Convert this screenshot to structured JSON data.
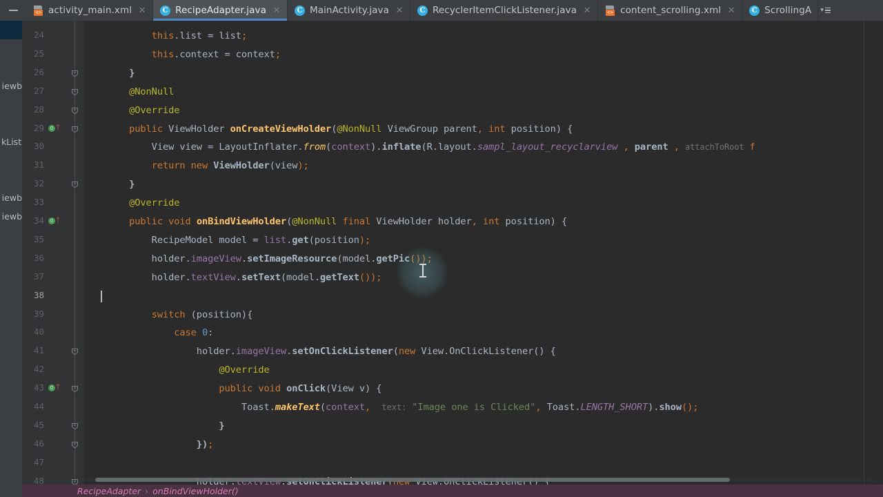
{
  "window": {
    "theme_bg": "#2b2b2b",
    "chrome_bg": "#3c3f41",
    "accent": "#4a88c7",
    "collapse_label": "—"
  },
  "tabs": {
    "items": [
      {
        "label": "activity_main.xml",
        "icon": "xml-file-icon",
        "icon_char": "<>",
        "active": false,
        "close": "✕"
      },
      {
        "label": "RecipeAdapter.java",
        "icon": "java-class-icon",
        "icon_char": "C",
        "active": true,
        "close": "✕"
      },
      {
        "label": "MainActivity.java",
        "icon": "java-class-icon",
        "icon_char": "C",
        "active": false,
        "close": "✕"
      },
      {
        "label": "RecyclerItemClickListener.java",
        "icon": "java-class-icon",
        "icon_char": "C",
        "active": false,
        "close": "✕"
      },
      {
        "label": "content_scrolling.xml",
        "icon": "xml-file-icon",
        "icon_char": "<>",
        "active": false,
        "close": "✕"
      },
      {
        "label": "ScrollingA",
        "icon": "java-class-icon",
        "icon_char": "C",
        "active": false,
        "close": ""
      }
    ],
    "overflow_label": "▾"
  },
  "project_panel": {
    "rows": [
      {
        "text": "",
        "selected": true
      },
      {
        "text": "",
        "selected": false
      },
      {
        "text": "",
        "selected": false
      },
      {
        "text": "viewb",
        "selected": false
      },
      {
        "text": "",
        "selected": false
      },
      {
        "text": "",
        "selected": false
      },
      {
        "text": "kList",
        "selected": false
      },
      {
        "text": "",
        "selected": false
      },
      {
        "text": "",
        "selected": false
      },
      {
        "text": "viewb",
        "selected": false
      },
      {
        "text": "viewb",
        "selected": false
      }
    ]
  },
  "editor": {
    "first_line": 24,
    "current_line": 38,
    "caret": {
      "line": 38,
      "col": 9
    },
    "run_marker_lines": [
      29,
      34,
      43
    ],
    "run_marker_glyph": "O",
    "run_marker_arrow": "↑",
    "fold_lines": [
      26,
      27,
      28,
      29,
      32,
      41,
      43,
      45,
      46,
      48
    ],
    "line_numbers": [
      24,
      25,
      26,
      27,
      28,
      29,
      30,
      31,
      32,
      33,
      34,
      35,
      36,
      37,
      38,
      39,
      40,
      41,
      42,
      43,
      44,
      45,
      46,
      47,
      48
    ],
    "lines": [
      {
        "n": 24,
        "tokens": [
          {
            "t": "            ",
            "c": "plain"
          },
          {
            "t": "this",
            "c": "kw"
          },
          {
            "t": ".",
            "c": "plain"
          },
          {
            "t": "list",
            "c": "ident"
          },
          {
            "t": " = ",
            "c": "plain"
          },
          {
            "t": "list",
            "c": "ident"
          },
          {
            "t": ";",
            "c": "semi"
          }
        ]
      },
      {
        "n": 25,
        "tokens": [
          {
            "t": "            ",
            "c": "plain"
          },
          {
            "t": "this",
            "c": "kw"
          },
          {
            "t": ".",
            "c": "plain"
          },
          {
            "t": "context",
            "c": "ident"
          },
          {
            "t": " = ",
            "c": "plain"
          },
          {
            "t": "context",
            "c": "ident"
          },
          {
            "t": ";",
            "c": "semi"
          }
        ]
      },
      {
        "n": 26,
        "tokens": [
          {
            "t": "        }",
            "c": "bold"
          }
        ]
      },
      {
        "n": 27,
        "tokens": [
          {
            "t": "        ",
            "c": "plain"
          },
          {
            "t": "@NonNull",
            "c": "ann"
          }
        ]
      },
      {
        "n": 28,
        "tokens": [
          {
            "t": "        ",
            "c": "plain"
          },
          {
            "t": "@Override",
            "c": "ann"
          }
        ]
      },
      {
        "n": 29,
        "tokens": [
          {
            "t": "        ",
            "c": "plain"
          },
          {
            "t": "public",
            "c": "kw"
          },
          {
            "t": " ",
            "c": "plain"
          },
          {
            "t": "ViewHolder",
            "c": "ident"
          },
          {
            "t": " ",
            "c": "plain"
          },
          {
            "t": "onCreateViewHolder",
            "c": "mthb"
          },
          {
            "t": "(",
            "c": "plain"
          },
          {
            "t": "@NonNull",
            "c": "ann"
          },
          {
            "t": " ViewGroup parent",
            "c": "ident"
          },
          {
            "t": ",",
            "c": "semi"
          },
          {
            "t": " ",
            "c": "plain"
          },
          {
            "t": "int",
            "c": "kw"
          },
          {
            "t": " position",
            "c": "ident"
          },
          {
            "t": ") {",
            "c": "plain"
          }
        ]
      },
      {
        "n": 30,
        "tokens": [
          {
            "t": "            View view = LayoutInflater.",
            "c": "ident"
          },
          {
            "t": "from",
            "c": "mth-ital"
          },
          {
            "t": "(",
            "c": "plain"
          },
          {
            "t": "context",
            "c": "fld"
          },
          {
            "t": ").",
            "c": "plain"
          },
          {
            "t": "inflate",
            "c": "bold"
          },
          {
            "t": "(R.layout.",
            "c": "ident"
          },
          {
            "t": "sampl_layout_recyclarview",
            "c": "sfld"
          },
          {
            "t": " , ",
            "c": "semi"
          },
          {
            "t": "parent",
            "c": "bold"
          },
          {
            "t": " , ",
            "c": "semi"
          },
          {
            "t": "attachToRoot",
            "c": "hint"
          },
          {
            "t": " f",
            "c": "kw"
          }
        ]
      },
      {
        "n": 31,
        "tokens": [
          {
            "t": "            ",
            "c": "plain"
          },
          {
            "t": "return",
            "c": "kw"
          },
          {
            "t": " ",
            "c": "plain"
          },
          {
            "t": "new",
            "c": "kw"
          },
          {
            "t": " ",
            "c": "plain"
          },
          {
            "t": "ViewHolder",
            "c": "bold"
          },
          {
            "t": "(view",
            "c": "ident"
          },
          {
            "t": ");",
            "c": "semi"
          }
        ]
      },
      {
        "n": 32,
        "tokens": [
          {
            "t": "        }",
            "c": "bold"
          }
        ]
      },
      {
        "n": 33,
        "tokens": [
          {
            "t": "        ",
            "c": "plain"
          },
          {
            "t": "@Override",
            "c": "ann"
          }
        ]
      },
      {
        "n": 34,
        "tokens": [
          {
            "t": "        ",
            "c": "plain"
          },
          {
            "t": "public",
            "c": "kw"
          },
          {
            "t": " ",
            "c": "plain"
          },
          {
            "t": "void",
            "c": "kw"
          },
          {
            "t": " ",
            "c": "plain"
          },
          {
            "t": "onBindViewHolder",
            "c": "mthb"
          },
          {
            "t": "(",
            "c": "plain"
          },
          {
            "t": "@NonNull",
            "c": "ann"
          },
          {
            "t": " ",
            "c": "plain"
          },
          {
            "t": "final",
            "c": "kw"
          },
          {
            "t": " ViewHolder holder",
            "c": "ident"
          },
          {
            "t": ",",
            "c": "semi"
          },
          {
            "t": " ",
            "c": "plain"
          },
          {
            "t": "int",
            "c": "kw"
          },
          {
            "t": " position",
            "c": "ident"
          },
          {
            "t": ") {",
            "c": "plain"
          }
        ]
      },
      {
        "n": 35,
        "tokens": [
          {
            "t": "            RecipeModel model = ",
            "c": "ident"
          },
          {
            "t": "list",
            "c": "fld"
          },
          {
            "t": ".",
            "c": "plain"
          },
          {
            "t": "get",
            "c": "bold"
          },
          {
            "t": "(position",
            "c": "ident"
          },
          {
            "t": ");",
            "c": "semi"
          }
        ]
      },
      {
        "n": 36,
        "tokens": [
          {
            "t": "            holder.",
            "c": "ident"
          },
          {
            "t": "imageView",
            "c": "fld"
          },
          {
            "t": ".",
            "c": "plain"
          },
          {
            "t": "setImageResource",
            "c": "bold"
          },
          {
            "t": "(model.",
            "c": "ident"
          },
          {
            "t": "getPic",
            "c": "bold"
          },
          {
            "t": "());",
            "c": "semi"
          }
        ]
      },
      {
        "n": 37,
        "tokens": [
          {
            "t": "            holder.",
            "c": "ident"
          },
          {
            "t": "textView",
            "c": "fld"
          },
          {
            "t": ".",
            "c": "plain"
          },
          {
            "t": "setText",
            "c": "bold"
          },
          {
            "t": "(model.",
            "c": "ident"
          },
          {
            "t": "getText",
            "c": "bold"
          },
          {
            "t": "());",
            "c": "semi"
          }
        ]
      },
      {
        "n": 38,
        "tokens": [
          {
            "t": "",
            "c": "plain"
          }
        ]
      },
      {
        "n": 39,
        "tokens": [
          {
            "t": "            ",
            "c": "plain"
          },
          {
            "t": "switch",
            "c": "kw"
          },
          {
            "t": " (position){",
            "c": "ident"
          }
        ]
      },
      {
        "n": 40,
        "tokens": [
          {
            "t": "                ",
            "c": "plain"
          },
          {
            "t": "case",
            "c": "kw"
          },
          {
            "t": " ",
            "c": "plain"
          },
          {
            "t": "0",
            "c": "num"
          },
          {
            "t": ":",
            "c": "plain"
          }
        ]
      },
      {
        "n": 41,
        "tokens": [
          {
            "t": "                    holder.",
            "c": "ident"
          },
          {
            "t": "imageView",
            "c": "fld"
          },
          {
            "t": ".",
            "c": "plain"
          },
          {
            "t": "setOnClickListener",
            "c": "bold"
          },
          {
            "t": "(",
            "c": "plain"
          },
          {
            "t": "new",
            "c": "kw"
          },
          {
            "t": " View.OnClickListener() {",
            "c": "ident"
          }
        ]
      },
      {
        "n": 42,
        "tokens": [
          {
            "t": "                        ",
            "c": "plain"
          },
          {
            "t": "@Override",
            "c": "ann"
          }
        ]
      },
      {
        "n": 43,
        "tokens": [
          {
            "t": "                        ",
            "c": "plain"
          },
          {
            "t": "public",
            "c": "kw"
          },
          {
            "t": " ",
            "c": "plain"
          },
          {
            "t": "void",
            "c": "kw"
          },
          {
            "t": " ",
            "c": "plain"
          },
          {
            "t": "onClick",
            "c": "bold"
          },
          {
            "t": "(View v) {",
            "c": "ident"
          }
        ]
      },
      {
        "n": 44,
        "tokens": [
          {
            "t": "                            Toast.",
            "c": "ident"
          },
          {
            "t": "makeText",
            "c": "mth-ital-b"
          },
          {
            "t": "(",
            "c": "plain"
          },
          {
            "t": "context",
            "c": "fld"
          },
          {
            "t": ",",
            "c": "semi"
          },
          {
            "t": "  ",
            "c": "plain"
          },
          {
            "t": "text:",
            "c": "hint"
          },
          {
            "t": " ",
            "c": "plain"
          },
          {
            "t": "\"Image one is Clicked\"",
            "c": "str"
          },
          {
            "t": ",",
            "c": "semi"
          },
          {
            "t": " Toast.",
            "c": "ident"
          },
          {
            "t": "LENGTH_SHORT",
            "c": "sfld"
          },
          {
            "t": ").",
            "c": "plain"
          },
          {
            "t": "show",
            "c": "bold"
          },
          {
            "t": "();",
            "c": "semi"
          }
        ]
      },
      {
        "n": 45,
        "tokens": [
          {
            "t": "                        }",
            "c": "bold"
          }
        ]
      },
      {
        "n": 46,
        "tokens": [
          {
            "t": "                    })",
            "c": "bold"
          },
          {
            "t": ";",
            "c": "semi"
          }
        ]
      },
      {
        "n": 47,
        "tokens": [
          {
            "t": "",
            "c": "plain"
          }
        ]
      },
      {
        "n": 48,
        "tokens": [
          {
            "t": "                    holder.",
            "c": "ident"
          },
          {
            "t": "textView",
            "c": "fld"
          },
          {
            "t": ".",
            "c": "plain"
          },
          {
            "t": "setOnClickListener",
            "c": "bold"
          },
          {
            "t": "(",
            "c": "plain"
          },
          {
            "t": "new",
            "c": "kw"
          },
          {
            "t": " View.OnClickListener() {",
            "c": "ident"
          }
        ]
      }
    ]
  },
  "breadcrumb": {
    "class": "RecipeAdapter",
    "separator": "›",
    "method": "onBindViewHolder()"
  }
}
